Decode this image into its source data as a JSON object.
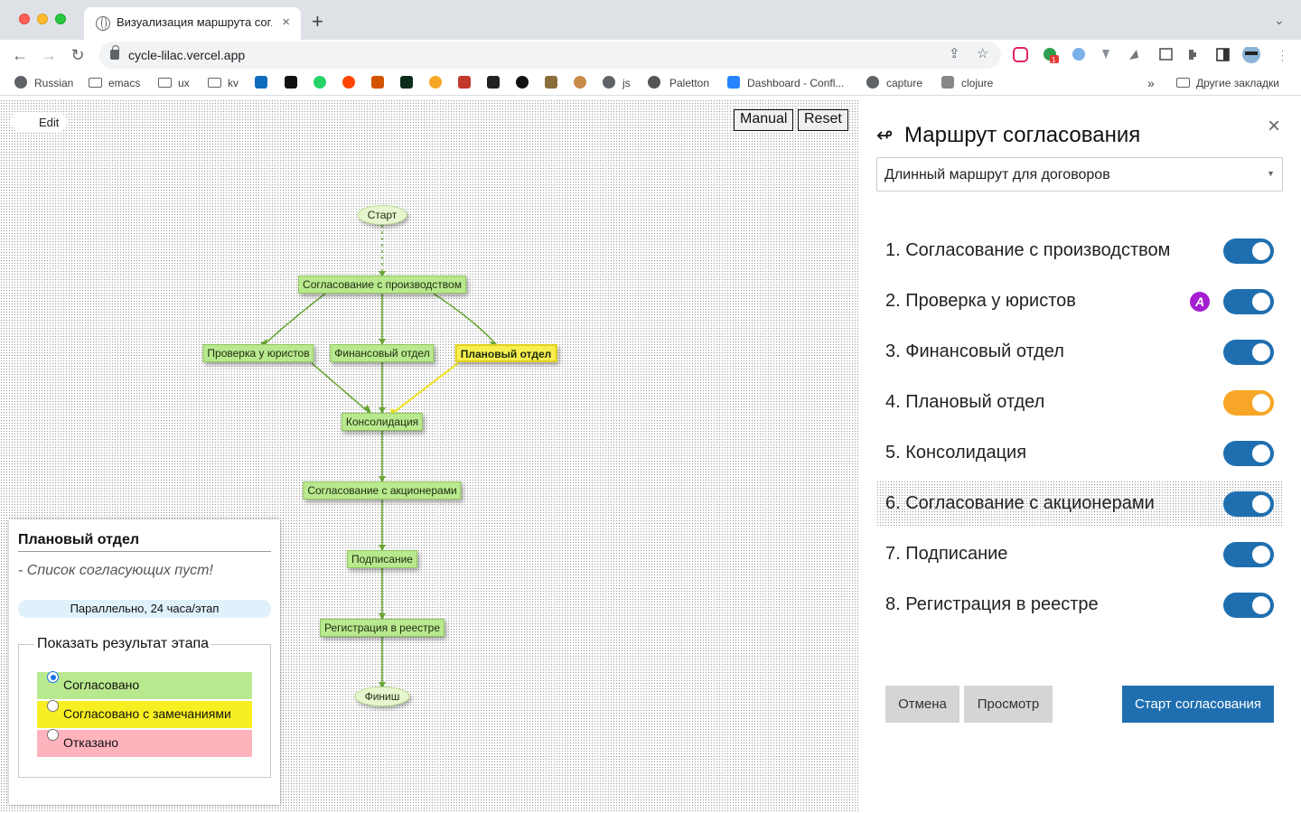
{
  "browser": {
    "tab_title": "Визуализация маршрута согласования",
    "tab_close": "×",
    "new_tab": "+",
    "tab_menu": "⌄",
    "url": "cycle-lilac.vercel.app",
    "ext_badge": "1",
    "bookmarks": [
      {
        "label": "Russian",
        "icon": "globe-icon"
      },
      {
        "label": "emacs",
        "icon": "folder-icon"
      },
      {
        "label": "ux",
        "icon": "folder-icon"
      },
      {
        "label": "kv",
        "icon": "folder-icon"
      },
      {
        "label": "",
        "icon": "outlook-icon"
      },
      {
        "label": "",
        "icon": "c-app-icon"
      },
      {
        "label": "",
        "icon": "whatsapp-icon"
      },
      {
        "label": "",
        "icon": "reddit-icon"
      },
      {
        "label": "",
        "icon": "gear-app-icon"
      },
      {
        "label": "",
        "icon": "terminal-icon"
      },
      {
        "label": "",
        "icon": "share-icon"
      },
      {
        "label": "",
        "icon": "yo-icon"
      },
      {
        "label": "",
        "icon": "m-icon"
      },
      {
        "label": "",
        "icon": "medium-icon"
      },
      {
        "label": "",
        "icon": "bridge-icon"
      },
      {
        "label": "",
        "icon": "dog-icon"
      },
      {
        "label": "js",
        "icon": "globe-icon"
      },
      {
        "label": "",
        "icon": "circle-icon"
      },
      {
        "label": "Paletton",
        "icon": "palette-icon"
      },
      {
        "label": "Dashboard - Confl...",
        "icon": "confluence-icon"
      },
      {
        "label": "capture",
        "icon": "globe-icon"
      },
      {
        "label": "clojure",
        "icon": "clojure-icon"
      }
    ],
    "bookmarks_more": "»",
    "other_bookmarks": "Другие закладки"
  },
  "canvas": {
    "edit_label": "Edit",
    "manual_label": "Manual",
    "reset_label": "Reset",
    "nodes": [
      {
        "id": "start",
        "label": "Старт",
        "shape": "oval"
      },
      {
        "id": "prod",
        "label": "Согласование с производством",
        "shape": "rect"
      },
      {
        "id": "legal",
        "label": "Проверка у юристов",
        "shape": "rect"
      },
      {
        "id": "fin",
        "label": "Финансовый отдел",
        "shape": "rect"
      },
      {
        "id": "plan",
        "label": "Плановый отдел",
        "shape": "rect",
        "selected": true
      },
      {
        "id": "cons",
        "label": "Консолидация",
        "shape": "rect"
      },
      {
        "id": "share",
        "label": "Согласование с акционерами",
        "shape": "rect"
      },
      {
        "id": "sign",
        "label": "Подписание",
        "shape": "rect"
      },
      {
        "id": "reg",
        "label": "Регистрация в реестре",
        "shape": "rect"
      },
      {
        "id": "finish",
        "label": "Финиш",
        "shape": "oval"
      }
    ],
    "edge_color": "#6aa736",
    "highlight_edge_color": "#f0e22a",
    "info": {
      "title": "Плановый отдел",
      "empty_text": "- Список согласующих пуст!",
      "mode": "Параллельно, 24 часа/этап",
      "result_legend": "Показать результат этапа",
      "options": [
        {
          "label": "Согласовано",
          "color": "#b9e98e",
          "checked": true
        },
        {
          "label": "Согласовано с замечаниями",
          "color": "#f7ef21",
          "checked": false
        },
        {
          "label": "Отказано",
          "color": "#ffb3bd",
          "checked": false
        }
      ]
    }
  },
  "panel": {
    "title": "Маршрут согласования",
    "close": "×",
    "route_select": "Длинный маршрут для договоров",
    "stages": [
      {
        "label": "1. Согласование с производством",
        "on": true,
        "color": "#1f6fb0"
      },
      {
        "label": "2. Проверка у юристов",
        "on": true,
        "color": "#1f6fb0",
        "badge": "A"
      },
      {
        "label": "3. Финансовый отдел",
        "on": true,
        "color": "#1f6fb0"
      },
      {
        "label": "4. Плановый отдел",
        "on": true,
        "color": "#f7a627"
      },
      {
        "label": "5. Консолидация",
        "on": true,
        "color": "#1f6fb0"
      },
      {
        "label": "6. Согласование с акционерами",
        "on": true,
        "color": "#1f6fb0",
        "highlighted": true
      },
      {
        "label": "7. Подписание",
        "on": true,
        "color": "#1f6fb0"
      },
      {
        "label": "8. Регистрация в реестре",
        "on": true,
        "color": "#1f6fb0"
      }
    ],
    "cancel_label": "Отмена",
    "preview_label": "Просмотр",
    "start_label": "Старт согласования"
  }
}
